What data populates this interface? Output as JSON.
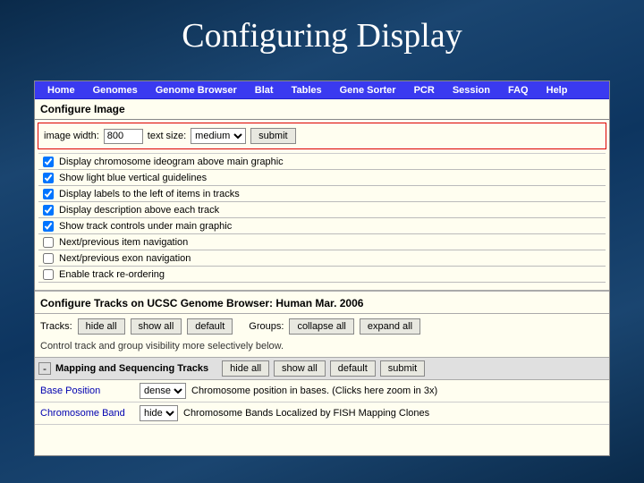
{
  "slide": {
    "title": "Configuring Display"
  },
  "nav": {
    "items": [
      "Home",
      "Genomes",
      "Genome Browser",
      "Blat",
      "Tables",
      "Gene Sorter",
      "PCR",
      "Session",
      "FAQ",
      "Help"
    ]
  },
  "sectionA": {
    "header": "Configure Image",
    "image_width_label": "image width:",
    "image_width_value": "800",
    "text_size_label": "text size:",
    "text_size_value": "medium",
    "submit": "submit"
  },
  "options": [
    {
      "checked": true,
      "label": "Display chromosome ideogram above main graphic"
    },
    {
      "checked": true,
      "label": "Show light blue vertical guidelines"
    },
    {
      "checked": true,
      "label": "Display labels to the left of items in tracks"
    },
    {
      "checked": true,
      "label": "Display description above each track"
    },
    {
      "checked": true,
      "label": "Show track controls under main graphic"
    },
    {
      "checked": false,
      "label": "Next/previous item navigation"
    },
    {
      "checked": false,
      "label": "Next/previous exon navigation"
    },
    {
      "checked": false,
      "label": "Enable track re-ordering"
    }
  ],
  "sectionB": {
    "header": "Configure Tracks on UCSC Genome Browser: Human Mar. 2006",
    "tracks_label": "Tracks:",
    "hide_all": "hide all",
    "show_all": "show all",
    "default": "default",
    "groups_label": "Groups:",
    "collapse_all": "collapse all",
    "expand_all": "expand all",
    "note": "Control track and group visibility more selectively below."
  },
  "group1": {
    "toggle": "-",
    "title": "Mapping and Sequencing Tracks",
    "hide_all": "hide all",
    "show_all": "show all",
    "default": "default",
    "submit": "submit"
  },
  "tracks": [
    {
      "name": "Base Position",
      "vis": "dense",
      "desc": "Chromosome position in bases. (Clicks here zoom in 3x)"
    },
    {
      "name": "Chromosome Band",
      "vis": "hide",
      "desc": "Chromosome Bands Localized by FISH Mapping Clones"
    }
  ]
}
